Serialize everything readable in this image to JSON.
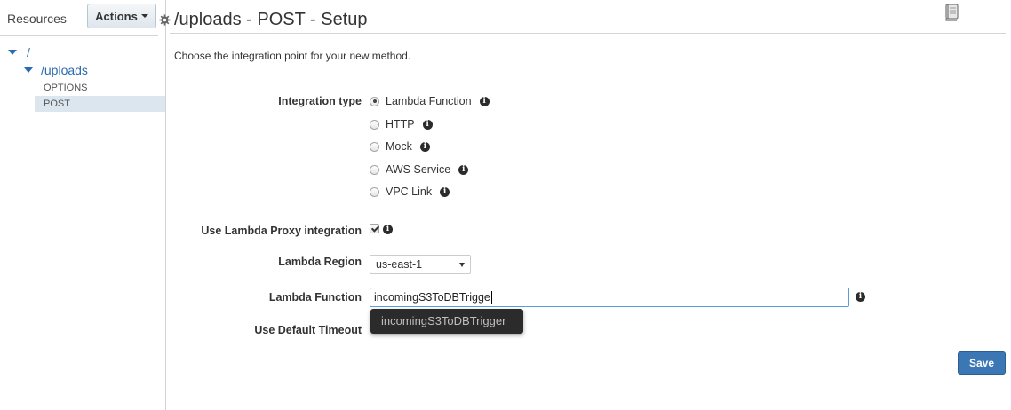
{
  "sidebar": {
    "title": "Resources",
    "actions_label": "Actions",
    "tree": {
      "root_label": "/",
      "uploads_label": "/uploads",
      "methods": [
        "OPTIONS",
        "POST"
      ]
    }
  },
  "header": {
    "title": "/uploads - POST - Setup",
    "subtitle": "Choose the integration point for your new method."
  },
  "form": {
    "integration_type_label": "Integration type",
    "integration_options": [
      "Lambda Function",
      "HTTP",
      "Mock",
      "AWS Service",
      "VPC Link"
    ],
    "selected_integration": "Lambda Function",
    "proxy_label": "Use Lambda Proxy integration",
    "proxy_checked": true,
    "region_label": "Lambda Region",
    "region_value": "us-east-1",
    "function_label": "Lambda Function",
    "function_value": "incomingS3ToDBTrigge",
    "suggestion": "incomingS3ToDBTrigger",
    "timeout_label": "Use Default Timeout",
    "save_label": "Save"
  },
  "colors": {
    "link": "#2a6ab0",
    "selected_row": "#dce6ef",
    "save_button": "#3a77b4",
    "input_focus_border": "#5b9dd9",
    "suggestion_bg": "#2b2b2b"
  },
  "icons": {
    "header": [
      "gear-icon",
      "book-icon"
    ],
    "info": "info-icon",
    "tree_expand": "triangle-down-icon"
  }
}
